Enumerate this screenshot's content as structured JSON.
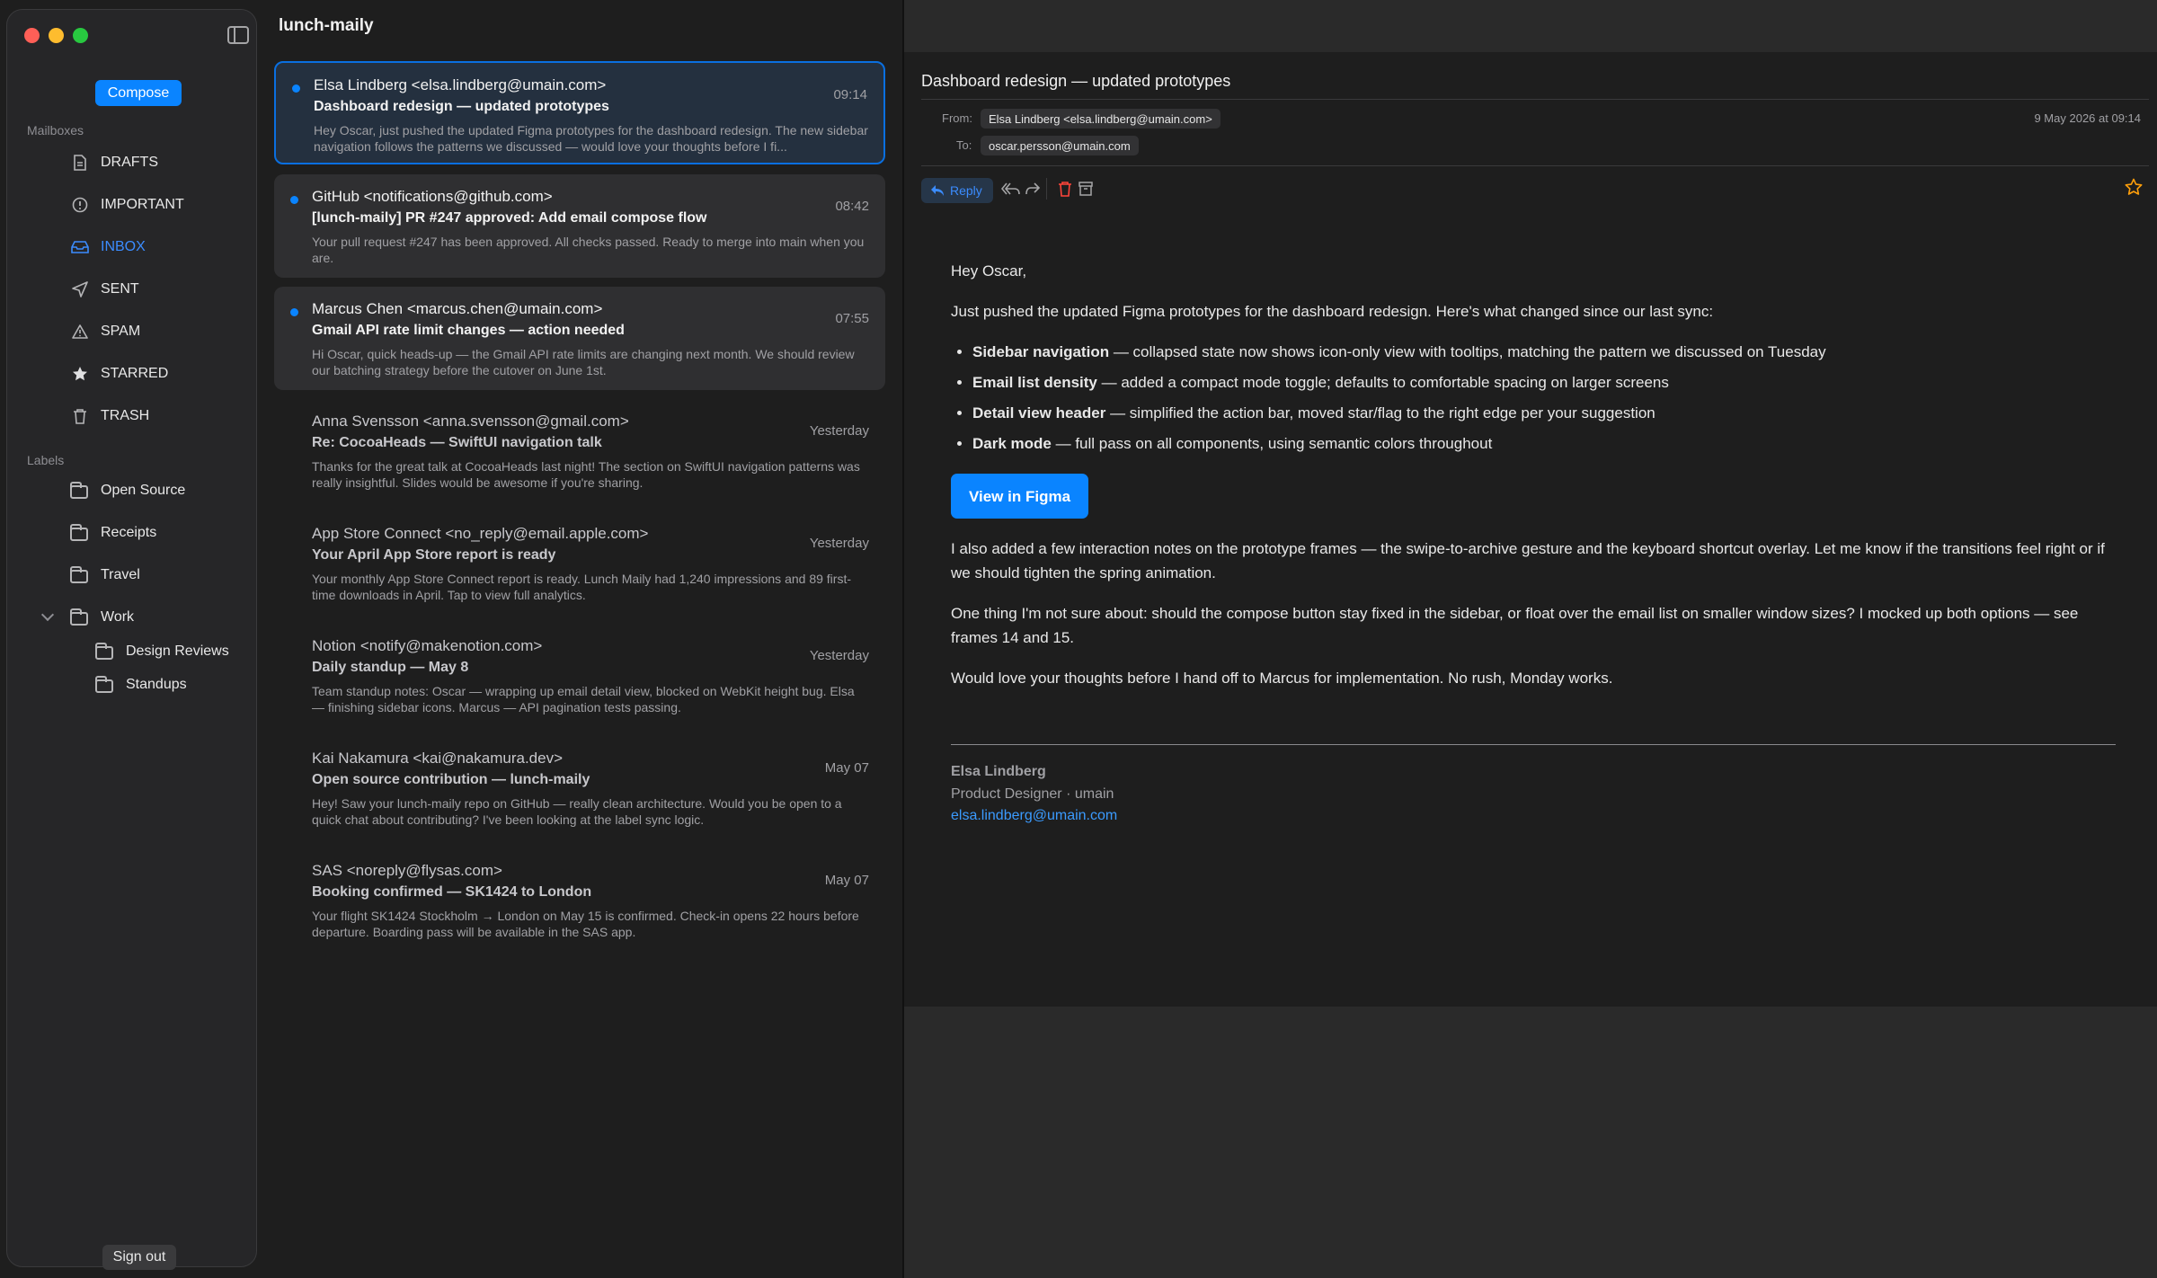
{
  "app": {
    "title": "lunch-maily"
  },
  "sidebar": {
    "compose_label": "Compose",
    "mailboxes_heading": "Mailboxes",
    "mailboxes": [
      {
        "label": "DRAFTS",
        "icon": "doc-icon"
      },
      {
        "label": "IMPORTANT",
        "icon": "exclamation-circle-icon"
      },
      {
        "label": "INBOX",
        "icon": "tray-icon",
        "active": true
      },
      {
        "label": "SENT",
        "icon": "paperplane-icon"
      },
      {
        "label": "SPAM",
        "icon": "warning-triangle-icon"
      },
      {
        "label": "STARRED",
        "icon": "star-icon"
      },
      {
        "label": "TRASH",
        "icon": "trash-icon"
      }
    ],
    "labels_heading": "Labels",
    "labels": [
      {
        "label": "Open Source"
      },
      {
        "label": "Receipts"
      },
      {
        "label": "Travel"
      },
      {
        "label": "Work",
        "expanded": true,
        "children": [
          {
            "label": "Design Reviews"
          },
          {
            "label": "Standups"
          }
        ]
      }
    ],
    "signout_label": "Sign out"
  },
  "emails": [
    {
      "sender": "Elsa Lindberg <elsa.lindberg@umain.com>",
      "subject": "Dashboard redesign — updated prototypes",
      "preview": "Hey Oscar, just pushed the updated Figma prototypes for the dashboard redesign. The new sidebar navigation follows the patterns we discussed — would love your thoughts before I fi...",
      "time": "09:14",
      "unread": true,
      "selected": true
    },
    {
      "sender": "GitHub <notifications@github.com>",
      "subject": "[lunch-maily] PR #247 approved: Add email compose flow",
      "preview": "Your pull request #247 has been approved. All checks passed. Ready to merge into main when you are.",
      "time": "08:42",
      "unread": true
    },
    {
      "sender": "Marcus Chen <marcus.chen@umain.com>",
      "subject": "Gmail API rate limit changes — action needed",
      "preview": "Hi Oscar, quick heads-up — the Gmail API rate limits are changing next month. We should review our batching strategy before the cutover on June 1st.",
      "time": "07:55",
      "unread": true
    },
    {
      "sender": "Anna Svensson <anna.svensson@gmail.com>",
      "subject": "Re: CocoaHeads — SwiftUI navigation talk",
      "preview": "Thanks for the great talk at CocoaHeads last night! The section on SwiftUI navigation patterns was really insightful. Slides would be awesome if you're sharing.",
      "time": "Yesterday"
    },
    {
      "sender": "App Store Connect <no_reply@email.apple.com>",
      "subject": "Your April App Store report is ready",
      "preview": "Your monthly App Store Connect report is ready. Lunch Maily had 1,240 impressions and 89 first-time downloads in April. Tap to view full analytics.",
      "time": "Yesterday"
    },
    {
      "sender": "Notion <notify@makenotion.com>",
      "subject": "Daily standup — May 8",
      "preview": "Team standup notes: Oscar — wrapping up email detail view, blocked on WebKit height bug. Elsa — finishing sidebar icons. Marcus — API pagination tests passing.",
      "time": "Yesterday"
    },
    {
      "sender": "Kai Nakamura <kai@nakamura.dev>",
      "subject": "Open source contribution — lunch-maily",
      "preview": "Hey! Saw your lunch-maily repo on GitHub — really clean architecture. Would you be open to a quick chat about contributing? I've been looking at the label sync logic.",
      "time": "May 07"
    },
    {
      "sender": "SAS <noreply@flysas.com>",
      "subject": "Booking confirmed — SK1424 to London",
      "preview": "Your flight SK1424 Stockholm → London on May 15 is confirmed. Check-in opens 22 hours before departure. Boarding pass will be available in the SAS app.",
      "time": "May 07"
    }
  ],
  "detail": {
    "subject": "Dashboard redesign — updated prototypes",
    "from_label": "From:",
    "from": "Elsa Lindberg <elsa.lindberg@umain.com>",
    "to_label": "To:",
    "to": "oscar.persson@umain.com",
    "date": "9 May 2026 at 09:14",
    "reply_label": "Reply",
    "body": {
      "greeting": "Hey Oscar,",
      "intro": "Just pushed the updated Figma prototypes for the dashboard redesign. Here's what changed since our last sync:",
      "bullets": [
        {
          "bold": "Sidebar navigation",
          "text": " — collapsed state now shows icon-only view with tooltips, matching the pattern we discussed on Tuesday"
        },
        {
          "bold": "Email list density",
          "text": " — added a compact mode toggle; defaults to comfortable spacing on larger screens"
        },
        {
          "bold": "Detail view header",
          "text": " — simplified the action bar, moved star/flag to the right edge per your suggestion"
        },
        {
          "bold": "Dark mode",
          "text": " — full pass on all components, using semantic colors throughout"
        }
      ],
      "button_label": "View in Figma",
      "para1": "I also added a few interaction notes on the prototype frames — the swipe-to-archive gesture and the keyboard shortcut overlay. Let me know if the transitions feel right or if we should tighten the spring animation.",
      "para2": "One thing I'm not sure about: should the compose button stay fixed in the sidebar, or float over the email list on smaller window sizes? I mocked up both options — see frames 14 and 15.",
      "para3": "Would love your thoughts before I hand off to Marcus for implementation. No rush, Monday works.",
      "sig_name": "Elsa Lindberg",
      "sig_role": "Product Designer · umain",
      "sig_email": "elsa.lindberg@umain.com"
    }
  },
  "colors": {
    "accent": "#0a84ff",
    "star": "#ff9f0a",
    "trash": "#ff453a"
  }
}
